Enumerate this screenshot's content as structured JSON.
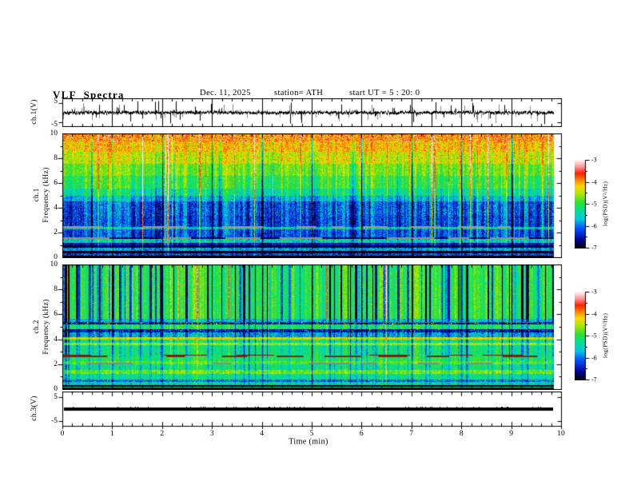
{
  "header": {
    "title": "VLF Spectra",
    "date": "Dec. 11, 2025",
    "station": "station= ATH",
    "start_ut": "start UT =  5 : 20: 0"
  },
  "xaxis": {
    "label": "Time  (min)",
    "tick_labels": [
      "0",
      "1",
      "2",
      "3",
      "4",
      "5",
      "6",
      "7",
      "8",
      "9",
      "10"
    ],
    "range_min": [
      0,
      10
    ]
  },
  "panels": {
    "ch1_wave": {
      "ylabel": "ch.1(V)",
      "ytick_labels": [
        "5",
        "-5"
      ],
      "ytick_values": [
        5,
        -5
      ]
    },
    "ch1_spec": {
      "ylabel_channel": "ch.1",
      "ylabel_axis": "Frequency  (kHz)",
      "ytick_labels": [
        "10",
        "8",
        "6",
        "4",
        "2",
        "0"
      ],
      "ytick_values": [
        10,
        8,
        6,
        4,
        2,
        0
      ]
    },
    "ch2_spec": {
      "ylabel_channel": "ch.2",
      "ylabel_axis": "Frequency  (kHz)",
      "ytick_labels": [
        "10",
        "8",
        "6",
        "4",
        "2",
        "0"
      ],
      "ytick_values": [
        10,
        8,
        6,
        4,
        2,
        0
      ]
    },
    "ch3_wave": {
      "ylabel": "ch.3(V)",
      "ytick_labels": [
        "5",
        "-5"
      ],
      "ytick_values": [
        5,
        -5
      ]
    }
  },
  "colorbar": {
    "label": "log(PSD)(V²/Hz)",
    "tick_labels": [
      "-3",
      "-4",
      "-5",
      "-6",
      "-7"
    ],
    "tick_values": [
      -3,
      -4,
      -5,
      -6,
      -7
    ],
    "range": [
      -3,
      -7
    ],
    "stops": [
      [
        0,
        "#000000"
      ],
      [
        0.09,
        "#000090"
      ],
      [
        0.22,
        "#0050ff"
      ],
      [
        0.33,
        "#00c8e0"
      ],
      [
        0.43,
        "#00e090"
      ],
      [
        0.52,
        "#30e030"
      ],
      [
        0.62,
        "#b0e800"
      ],
      [
        0.7,
        "#ffd800"
      ],
      [
        0.78,
        "#ff8000"
      ],
      [
        0.85,
        "#ff2000"
      ],
      [
        0.92,
        "#ff9090"
      ],
      [
        1,
        "#fff4f4"
      ]
    ]
  },
  "chart_data": [
    {
      "type": "line",
      "name": "ch1_waveform",
      "xlim": [
        0,
        10
      ],
      "ylim": [
        -6,
        6
      ],
      "xunit": "min",
      "yunit": "V",
      "yticks": [
        5,
        -5
      ],
      "summary": "broadband noisy time series centered near 0 V with impulsive spikes up to about ±5 V, vertical minute grid lines",
      "render": {
        "seed": 101,
        "spike_p": 0.11,
        "spike_amp": 4.3,
        "noise": 0.5,
        "gray_p": 0.16
      }
    },
    {
      "type": "heatmap",
      "name": "ch1_spectrogram",
      "xlim": [
        0,
        10
      ],
      "ylim": [
        0,
        10
      ],
      "zlim": [
        -7,
        -3
      ],
      "zlabel": "log(PSD)(V²/Hz)",
      "seed": 202,
      "bands": [
        {
          "f": [
            9.4,
            10.0
          ],
          "v": -4.0,
          "n": 0.45,
          "cs": 0.5,
          "ss": 0.6,
          "spk": [
            0.22,
            0.55
          ]
        },
        {
          "f": [
            8.6,
            9.4
          ],
          "v": -4.2,
          "n": 0.38,
          "cs": 0.6,
          "ss": 0.7,
          "spk": [
            0.1,
            0.5
          ]
        },
        {
          "f": [
            7.6,
            8.6
          ],
          "v": -4.45,
          "n": 0.35,
          "cs": 0.7,
          "ss": 0.8,
          "spk": [
            0.05,
            0.5
          ]
        },
        {
          "f": [
            6.6,
            7.6
          ],
          "v": -4.75,
          "n": 0.32,
          "cs": 0.8,
          "ss": 0.9
        },
        {
          "f": [
            5.6,
            6.6
          ],
          "v": -5.0,
          "n": 0.3,
          "cs": 0.9,
          "ss": 1.0
        },
        {
          "f": [
            5.0,
            5.6
          ],
          "v": -5.3,
          "n": 0.32,
          "cs": 1.0,
          "ss": 1.0
        },
        {
          "f": [
            4.55,
            5.0
          ],
          "v": -5.7,
          "n": 0.38,
          "cs": 1.1,
          "ss": 1.0
        },
        {
          "f": [
            3.4,
            4.55
          ],
          "v": -6.15,
          "n": 0.45,
          "cs": 1.2,
          "ss": 0.95
        },
        {
          "f": [
            2.5,
            3.4
          ],
          "v": -6.25,
          "n": 0.42,
          "cs": 1.1,
          "ss": 0.9
        },
        {
          "f": [
            2.3,
            2.5
          ],
          "v": -5.5,
          "n": 0.45,
          "cs": 0.8,
          "ss": 0.8
        },
        {
          "f": [
            1.65,
            2.3
          ],
          "v": -6.2,
          "n": 0.4,
          "cs": 1.0,
          "ss": 0.8
        },
        {
          "f": [
            1.5,
            1.65
          ],
          "v": -6.8,
          "n": 0.25,
          "cs": 0.5,
          "ss": 0.5
        },
        {
          "f": [
            1.2,
            1.5
          ],
          "v": -5.5,
          "n": 0.55,
          "cs": 0.6,
          "ss": 0.6
        },
        {
          "f": [
            0.95,
            1.2
          ],
          "v": -6.5,
          "n": 0.4,
          "cs": 0.7,
          "ss": 0.5
        },
        {
          "f": [
            0.75,
            0.95
          ],
          "v": -6.85,
          "n": 0.2,
          "cs": 0.3,
          "ss": 0.3
        },
        {
          "f": [
            0.5,
            0.75
          ],
          "v": -5.8,
          "n": 0.6,
          "cs": 0.5,
          "ss": 0.4
        },
        {
          "f": [
            0.3,
            0.5
          ],
          "v": -6.9,
          "n": 0.15,
          "cs": 0.2,
          "ss": 0.2
        },
        {
          "f": [
            0.15,
            0.3
          ],
          "v": -6.2,
          "n": 0.5,
          "cs": 0.3,
          "ss": 0.3
        },
        {
          "f": [
            0.0,
            0.15
          ],
          "v": -7.0,
          "n": 0.05,
          "cs": 0.1,
          "ss": 0.1
        }
      ],
      "streaks": {
        "bright": 38,
        "strong": 9,
        "dark": 16
      },
      "dash": [
        {
          "f": 2.47,
          "color": "#9a9a8c",
          "h": 2
        },
        {
          "f": 1.58,
          "color": "#8f8f82",
          "h": 2
        }
      ],
      "minute_gap_lines": true
    },
    {
      "type": "heatmap",
      "name": "ch2_spectrogram",
      "xlim": [
        0,
        10
      ],
      "ylim": [
        0,
        10
      ],
      "zlim": [
        -7,
        -3
      ],
      "zlabel": "log(PSD)(V²/Hz)",
      "seed": 303,
      "bands": [
        {
          "f": [
            5.65,
            10.0
          ],
          "v": -5.0,
          "n": 0.28,
          "cs": 0.9,
          "ss": 1.3
        },
        {
          "f": [
            5.45,
            5.65
          ],
          "v": -5.6,
          "n": 0.4,
          "cs": 0.5,
          "ss": 0.6
        },
        {
          "f": [
            5.25,
            5.45
          ],
          "v": -6.5,
          "n": 0.4,
          "cs": 0.3,
          "ss": 0.3,
          "spk": [
            0.1,
            2.2
          ]
        },
        {
          "f": [
            4.85,
            5.25
          ],
          "v": -5.05,
          "n": 0.3,
          "cs": 0.5,
          "ss": 0.5
        },
        {
          "f": [
            4.6,
            4.85
          ],
          "v": -6.45,
          "n": 0.4,
          "cs": 0.3,
          "ss": 0.3,
          "spk": [
            0.05,
            1.8
          ]
        },
        {
          "f": [
            4.2,
            4.6
          ],
          "v": -5.75,
          "n": 0.45,
          "cs": 0.5,
          "ss": 0.5
        },
        {
          "f": [
            4.02,
            4.2
          ],
          "v": -4.35,
          "n": 0.4,
          "cs": 0.3,
          "ss": 0.3
        },
        {
          "f": [
            3.75,
            4.02
          ],
          "v": -5.2,
          "n": 0.3,
          "cs": 0.6,
          "ss": 0.5
        },
        {
          "f": [
            3.55,
            3.75
          ],
          "v": -4.5,
          "n": 0.4,
          "cs": 0.4,
          "ss": 0.3
        },
        {
          "f": [
            2.8,
            3.55
          ],
          "v": -5.2,
          "n": 0.32,
          "cs": 0.6,
          "ss": 0.5
        },
        {
          "f": [
            2.55,
            2.8
          ],
          "v": -5.15,
          "n": 0.35,
          "cs": 0.5,
          "ss": 0.4
        },
        {
          "f": [
            2.25,
            2.55
          ],
          "v": -5.05,
          "n": 0.3,
          "cs": 0.5,
          "ss": 0.4
        },
        {
          "f": [
            2.0,
            2.25
          ],
          "v": -4.8,
          "n": 0.35,
          "cs": 0.4,
          "ss": 0.3
        },
        {
          "f": [
            1.55,
            2.0
          ],
          "v": -5.2,
          "n": 0.35,
          "cs": 0.5,
          "ss": 0.4
        },
        {
          "f": [
            1.25,
            1.55
          ],
          "v": -4.7,
          "n": 0.4,
          "cs": 0.4,
          "ss": 0.3
        },
        {
          "f": [
            0.75,
            1.25
          ],
          "v": -5.25,
          "n": 0.35,
          "cs": 0.5,
          "ss": 0.3
        },
        {
          "f": [
            0.6,
            0.75
          ],
          "v": -6.0,
          "n": 0.5,
          "cs": 0.3,
          "ss": 0.2
        },
        {
          "f": [
            0.3,
            0.6
          ],
          "v": -5.4,
          "n": 0.5,
          "cs": 0.3,
          "ss": 0.2
        },
        {
          "f": [
            0.2,
            0.3
          ],
          "v": -6.9,
          "n": 0.15,
          "cs": 0.1,
          "ss": 0.1
        },
        {
          "f": [
            0.12,
            0.2
          ],
          "v": -5.2,
          "n": 0.4,
          "cs": 0.2,
          "ss": 0.1
        },
        {
          "f": [
            0.0,
            0.12
          ],
          "v": -7.0,
          "n": 0.05,
          "cs": 0.1,
          "ss": 0.1
        }
      ],
      "streaks": {
        "darkwide": 75,
        "bright": 10,
        "lines": 8
      },
      "dash": [
        {
          "f": 2.62,
          "color": "#7a2414",
          "h": 2
        },
        {
          "f": 2.74,
          "color": "#6d2010",
          "h": 1
        },
        {
          "f": 2.08,
          "color": "#8a8a80",
          "h": 2
        },
        {
          "f": 5.35,
          "color": "#b05a10",
          "h": 1
        }
      ],
      "minute_gap_lines": true
    },
    {
      "type": "line",
      "name": "ch3_waveform",
      "xlim": [
        0,
        10
      ],
      "ylim": [
        -6,
        6
      ],
      "xunit": "min",
      "yunit": "V",
      "yticks": [
        5,
        -5
      ],
      "summary": "constant flat signal at 0 V drawn as a thick black horizontal line (channel inactive)",
      "render": {
        "seed": 404,
        "flat_value": 0,
        "thickness": 4
      }
    }
  ]
}
